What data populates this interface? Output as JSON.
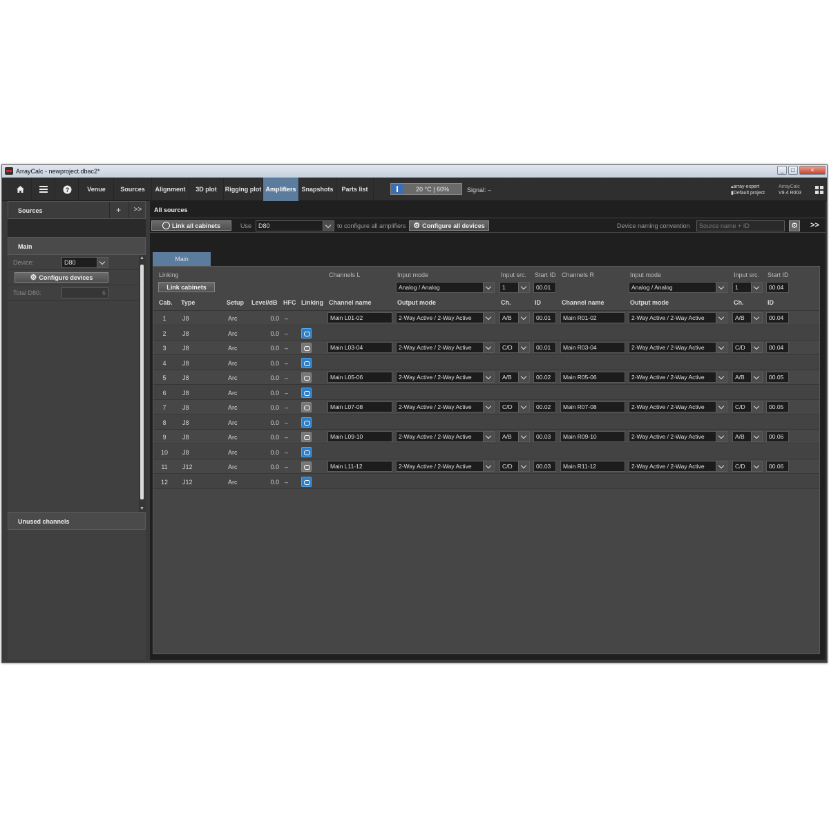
{
  "window": {
    "title": "ArrayCalc - newproject.dbac2*",
    "min": "_",
    "max": "□",
    "close": "×"
  },
  "toolbar": {
    "home_icon": "home-icon",
    "menu_icon": "menu-icon",
    "help_icon": "help-icon",
    "tabs": [
      "Venue",
      "Sources",
      "Alignment",
      "3D plot",
      "Rigging plot",
      "Amplifiers",
      "Snapshots",
      "Parts list"
    ],
    "active_tab": "Amplifiers",
    "temperature": "20 °C | 60%",
    "signal": "Signal: –",
    "project_user": "array-expert",
    "project_name": "Default project",
    "app_name": "ArrayCalc",
    "version": "V9.4 R003"
  },
  "left": {
    "sources_title": "Sources",
    "add": "+",
    "expand": ">>",
    "group_title": "Main",
    "device_label": "Device:",
    "device_value": "D80",
    "configure_button": "Configure devices",
    "total_label": "Total D80:",
    "total_value": "6",
    "unused_title": "Unused channels"
  },
  "right": {
    "title": "All sources",
    "link_all": "Link all cabinets",
    "use_label": "Use",
    "use_value": "D80",
    "configure_text": "to configure all amplifiers",
    "configure_all": "Configure all devices",
    "naming_label": "Device naming convention",
    "naming_placeholder": "Source name + ID",
    "expand": ">>",
    "tab": "Main"
  },
  "table": {
    "linking_label": "Linking",
    "link_cabinets": "Link cabinets",
    "channels_l": "Channels L",
    "channels_r": "Channels R",
    "input_mode_label": "Input mode",
    "input_src_label": "Input src.",
    "start_id_label": "Start ID",
    "input_mode_l": "Analog / Analog",
    "input_src_l": "1",
    "start_id_l": "00.01",
    "input_mode_r": "Analog / Analog",
    "input_src_r": "1",
    "start_id_r": "00.04",
    "headers": [
      "Cab.",
      "Type",
      "Setup",
      "Level/dB",
      "HFC",
      "Linking",
      "Channel name",
      "Output mode",
      "Ch.",
      "ID",
      "Channel name",
      "Output mode",
      "Ch.",
      "ID"
    ],
    "rows": [
      {
        "cab": "1",
        "type": "J8",
        "setup": "Arc",
        "level": "0.0",
        "hfc": "–",
        "link": "none",
        "l_name": "Main L01-02",
        "l_mode": "2-Way Active / 2-Way Active",
        "l_ch": "A/B",
        "l_id": "00.01",
        "r_name": "Main R01-02",
        "r_mode": "2-Way Active / 2-Way Active",
        "r_ch": "A/B",
        "r_id": "00.04"
      },
      {
        "cab": "2",
        "type": "J8",
        "setup": "Arc",
        "level": "0.0",
        "hfc": "–",
        "link": "blue"
      },
      {
        "cab": "3",
        "type": "J8",
        "setup": "Arc",
        "level": "0.0",
        "hfc": "–",
        "link": "grey",
        "l_name": "Main L03-04",
        "l_mode": "2-Way Active / 2-Way Active",
        "l_ch": "C/D",
        "l_id": "00.01",
        "r_name": "Main R03-04",
        "r_mode": "2-Way Active / 2-Way Active",
        "r_ch": "C/D",
        "r_id": "00.04"
      },
      {
        "cab": "4",
        "type": "J8",
        "setup": "Arc",
        "level": "0.0",
        "hfc": "–",
        "link": "blue"
      },
      {
        "cab": "5",
        "type": "J8",
        "setup": "Arc",
        "level": "0.0",
        "hfc": "–",
        "link": "grey",
        "l_name": "Main L05-06",
        "l_mode": "2-Way Active / 2-Way Active",
        "l_ch": "A/B",
        "l_id": "00.02",
        "r_name": "Main R05-06",
        "r_mode": "2-Way Active / 2-Way Active",
        "r_ch": "A/B",
        "r_id": "00.05"
      },
      {
        "cab": "6",
        "type": "J8",
        "setup": "Arc",
        "level": "0.0",
        "hfc": "–",
        "link": "blue"
      },
      {
        "cab": "7",
        "type": "J8",
        "setup": "Arc",
        "level": "0.0",
        "hfc": "–",
        "link": "grey",
        "l_name": "Main L07-08",
        "l_mode": "2-Way Active / 2-Way Active",
        "l_ch": "C/D",
        "l_id": "00.02",
        "r_name": "Main R07-08",
        "r_mode": "2-Way Active / 2-Way Active",
        "r_ch": "C/D",
        "r_id": "00.05"
      },
      {
        "cab": "8",
        "type": "J8",
        "setup": "Arc",
        "level": "0.0",
        "hfc": "–",
        "link": "blue"
      },
      {
        "cab": "9",
        "type": "J8",
        "setup": "Arc",
        "level": "0.0",
        "hfc": "–",
        "link": "grey",
        "l_name": "Main L09-10",
        "l_mode": "2-Way Active / 2-Way Active",
        "l_ch": "A/B",
        "l_id": "00.03",
        "r_name": "Main R09-10",
        "r_mode": "2-Way Active / 2-Way Active",
        "r_ch": "A/B",
        "r_id": "00.06"
      },
      {
        "cab": "10",
        "type": "J8",
        "setup": "Arc",
        "level": "0.0",
        "hfc": "–",
        "link": "blue"
      },
      {
        "cab": "11",
        "type": "J12",
        "setup": "Arc",
        "level": "0.0",
        "hfc": "–",
        "link": "grey",
        "l_name": "Main L11-12",
        "l_mode": "2-Way Active / 2-Way Active",
        "l_ch": "C/D",
        "l_id": "00.03",
        "r_name": "Main R11-12",
        "r_mode": "2-Way Active / 2-Way Active",
        "r_ch": "C/D",
        "r_id": "00.06"
      },
      {
        "cab": "12",
        "type": "J12",
        "setup": "Arc",
        "level": "0.0",
        "hfc": "–",
        "link": "blue"
      }
    ]
  }
}
